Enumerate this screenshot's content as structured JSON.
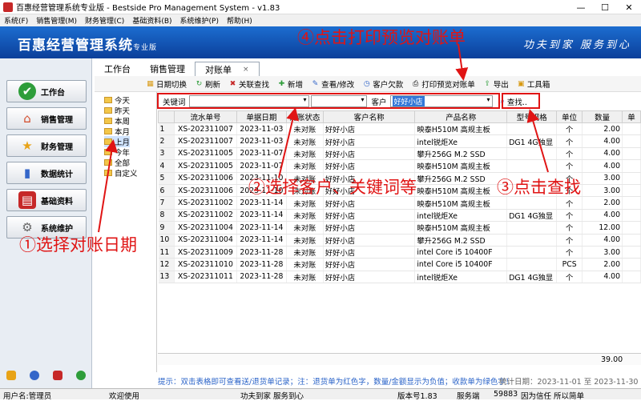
{
  "window": {
    "title": "百惠经营管理系统专业版 - Bestside Pro Management System - v1.83",
    "min": "—",
    "max": "☐",
    "close": "✕"
  },
  "menu": [
    "系统(F)",
    "销售管理(M)",
    "财务管理(C)",
    "基础资料(B)",
    "系统维护(P)",
    "帮助(H)"
  ],
  "banner": {
    "brand": "百惠经营管理系统",
    "edition": "专业版",
    "slogan": "功夫到家 服务到心"
  },
  "nav": [
    {
      "label": "工作台",
      "icon": "check-icon",
      "color": "#2e9d3a"
    },
    {
      "label": "销售管理",
      "icon": "house-icon",
      "color": "#d34b2a"
    },
    {
      "label": "财务管理",
      "icon": "star-icon",
      "color": "#e8a317"
    },
    {
      "label": "数据统计",
      "icon": "bar-chart-icon",
      "color": "#3466c9"
    },
    {
      "label": "基础资料",
      "icon": "book-icon",
      "color": "#c62828"
    },
    {
      "label": "系统维护",
      "icon": "gear-icon",
      "color": "#666666"
    }
  ],
  "tabs": [
    {
      "label": "工作台"
    },
    {
      "label": "销售管理"
    },
    {
      "label": "对账单",
      "close": "×"
    }
  ],
  "toolbar": [
    {
      "label": "日期切换",
      "icon": "calendar-icon"
    },
    {
      "label": "刷新",
      "icon": "refresh-icon"
    },
    {
      "label": "关联查找",
      "icon": "link-close-icon"
    },
    {
      "label": "新增",
      "icon": "plus-icon"
    },
    {
      "label": "查看/修改",
      "icon": "edit-icon"
    },
    {
      "label": "客户欠款",
      "icon": "clock-icon"
    },
    {
      "label": "打印预览对账单",
      "icon": "print-icon"
    },
    {
      "label": "导出",
      "icon": "export-icon"
    },
    {
      "label": "工具箱",
      "icon": "toolbox-icon"
    }
  ],
  "tree": [
    "今天",
    "昨天",
    "本周",
    "本月",
    "上月",
    "今年",
    "全部",
    "自定义"
  ],
  "filter": {
    "keyword_label": "关键词",
    "keyword_value": "",
    "customer_label": "客户",
    "customer_value": "好好小店",
    "search": "查找.."
  },
  "columns": [
    "",
    "流水单号",
    "单据日期",
    "对账状态",
    "客户名称",
    "产品名称",
    "型号规格",
    "单位",
    "数量",
    "单"
  ],
  "rows": [
    [
      "1",
      "XS-202311007",
      "2023-11-03",
      "未对账",
      "好好小店",
      "映泰H510M 高规主板",
      "",
      "个",
      "2.00"
    ],
    [
      "2",
      "XS-202311007",
      "2023-11-03",
      "未对账",
      "好好小店",
      "intel锐炬Xe",
      "DG1 4G独显",
      "个",
      "4.00"
    ],
    [
      "3",
      "XS-202311005",
      "2023-11-07",
      "未对账",
      "好好小店",
      "攀升256G M.2 SSD",
      "",
      "个",
      "4.00"
    ],
    [
      "4",
      "XS-202311005",
      "2023-11-07",
      "未对账",
      "好好小店",
      "映泰H510M 高规主板",
      "",
      "个",
      "4.00"
    ],
    [
      "5",
      "XS-202311006",
      "2023-11-10",
      "未对账",
      "好好小店",
      "攀升256G M.2 SSD",
      "",
      "个",
      "3.00"
    ],
    [
      "6",
      "XS-202311006",
      "2023-11-10",
      "未对账",
      "好好小店",
      "映泰H510M 高规主板",
      "",
      "个",
      "3.00"
    ],
    [
      "7",
      "XS-202311002",
      "2023-11-14",
      "未对账",
      "好好小店",
      "映泰H510M 高规主板",
      "",
      "个",
      "2.00"
    ],
    [
      "8",
      "XS-202311002",
      "2023-11-14",
      "未对账",
      "好好小店",
      "intel锐炬Xe",
      "DG1 4G独显",
      "个",
      "4.00"
    ],
    [
      "9",
      "XS-202311004",
      "2023-11-14",
      "未对账",
      "好好小店",
      "映泰H510M 高规主板",
      "",
      "个",
      "12.00"
    ],
    [
      "10",
      "XS-202311004",
      "2023-11-14",
      "未对账",
      "好好小店",
      "攀升256G M.2 SSD",
      "",
      "个",
      "4.00"
    ],
    [
      "11",
      "XS-202311009",
      "2023-11-28",
      "未对账",
      "好好小店",
      "intel Core i5 10400F",
      "",
      "个",
      "3.00"
    ],
    [
      "12",
      "XS-202311010",
      "2023-11-28",
      "未对账",
      "好好小店",
      "intel Core i5 10400F",
      "",
      "PCS",
      "2.00"
    ],
    [
      "13",
      "XS-202311011",
      "2023-11-28",
      "未对账",
      "好好小店",
      "intel锐炬Xe",
      "DG1 4G独显",
      "个",
      "4.00"
    ]
  ],
  "total": "39.00",
  "hint": {
    "text": "提示：双击表格即可查看送/退货单记录；注：退货单为红色字，数量/金额显示为负值；收款单为绿色字！",
    "date_range": "统计日期：2023-11-01 至 2023-11-30"
  },
  "status": {
    "user": "用户名:管理员",
    "welcome": "欢迎使用",
    "motto": "功夫到家 服务到心",
    "version": "版本号1.83",
    "service": "服务端",
    "port": "59883",
    "trust": "因为信任 所以简单"
  },
  "annotations": {
    "step1": "①选择对账日期",
    "step2": "②选择客户、关键词等",
    "step3": "③点击查找",
    "step4": "④点击打印预览对账单"
  },
  "accent": "#e01414"
}
